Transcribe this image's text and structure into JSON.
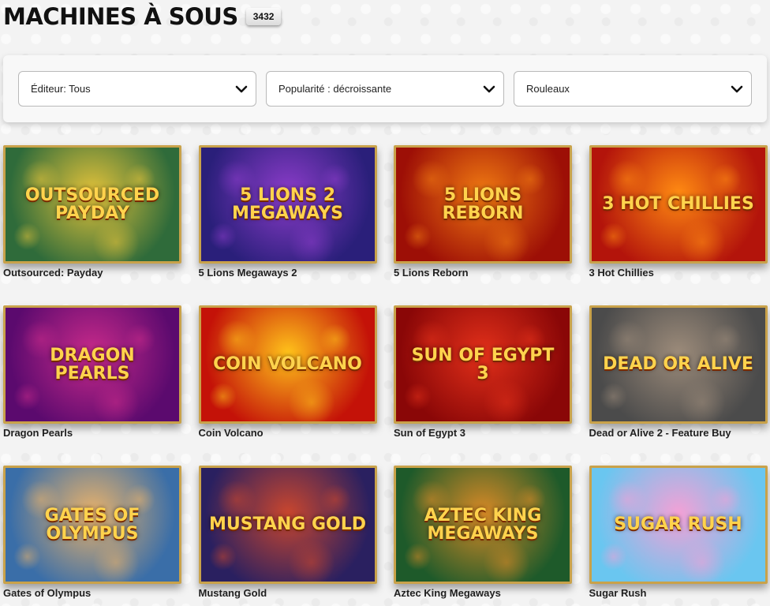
{
  "page": {
    "title": "MACHINES À SOUS",
    "count": "3432"
  },
  "filters": [
    {
      "label": "Éditeur: Tous"
    },
    {
      "label": "Popularité : décroissante"
    },
    {
      "label": "Rouleaux"
    }
  ],
  "games": [
    {
      "name": "Outsourced: Payday",
      "logo": "OUTSOURCED PAYDAY",
      "bg": [
        "#2f6b3a",
        "#e3c23a"
      ]
    },
    {
      "name": "5 Lions Megaways 2",
      "logo": "5 LIONS 2 MEGAWAYS",
      "bg": [
        "#2a1f7a",
        "#8b3cc9"
      ]
    },
    {
      "name": "5 Lions Reborn",
      "logo": "5 LIONS REBORN",
      "bg": [
        "#9d0f06",
        "#f07a12"
      ]
    },
    {
      "name": "3 Hot Chillies",
      "logo": "3 HOT CHILLIES",
      "bg": [
        "#b3140b",
        "#ff8a12"
      ]
    },
    {
      "name": "Dragon Pearls",
      "logo": "DRAGON PEARLS",
      "bg": [
        "#5b0a6e",
        "#c82a8a"
      ]
    },
    {
      "name": "Coin Volcano",
      "logo": "COIN VOLCANO",
      "bg": [
        "#c41208",
        "#ffc21a"
      ]
    },
    {
      "name": "Sun of Egypt 3",
      "logo": "SUN OF EGYPT 3",
      "bg": [
        "#8a0707",
        "#e2301a"
      ]
    },
    {
      "name": "Dead or Alive 2 - Feature Buy",
      "logo": "DEAD OR ALIVE",
      "bg": [
        "#4b4b4b",
        "#9c8b7a"
      ]
    },
    {
      "name": "Gates of Olympus",
      "logo": "GATES OF OLYMPUS",
      "bg": [
        "#3a6ea8",
        "#e9b26b"
      ]
    },
    {
      "name": "Mustang Gold",
      "logo": "MUSTANG GOLD",
      "bg": [
        "#2a2060",
        "#c9462e"
      ]
    },
    {
      "name": "Aztec King Megaways",
      "logo": "AZTEC KING MEGAWAYS",
      "bg": [
        "#1e5a2a",
        "#d98a26"
      ]
    },
    {
      "name": "Sugar Rush",
      "logo": "SUGAR RUSH",
      "bg": [
        "#6ac6f0",
        "#f3a1d6"
      ]
    }
  ]
}
